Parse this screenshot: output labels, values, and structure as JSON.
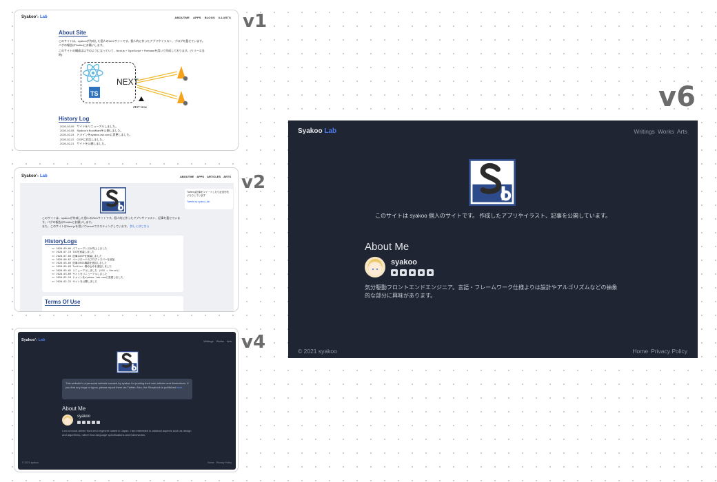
{
  "versions": {
    "v1": "v1",
    "v2": "v2",
    "v4": "v4",
    "v6": "v6"
  },
  "v1": {
    "brand_a": "Syakoo'",
    "brand_sep": "s",
    "brand_b": "Lab",
    "nav": [
      "ABOUTME",
      "APPS",
      "BLOGS",
      "ILLUSTS"
    ],
    "about_title": "About Site",
    "about_p1": "このサイトは、syakooが作成した個人のWebサイトです。個人的に作ったアプリやイラスト、ブログを載せています。バグの報告はTwitterにお願いします。",
    "about_p2": "このサイトの構成は以下のようになっていて、Next.js + TypeScript + Firebaseを用いて作成しております。(リリース当時)",
    "stack_next": "NEXT",
    "stack_ts": "TS",
    "stack_zeit": "ZEIT Now",
    "history_title": "History Log",
    "history": [
      "2020-03-09　サイトをリニューアルしました。",
      "2020-03-08　Syakoo's BookMarkを公開しました。",
      "2020-02-24　ドメインをsyakoo-lab.comに変更しました。",
      "2020-02-22　OGPに対応しました。",
      "2020-02-21　サイトを公開しました。"
    ]
  },
  "v2": {
    "brand_a": "Syakoo'",
    "brand_sep": "s",
    "brand_b": "Lab",
    "nav": [
      "ABOUTME",
      "APPS",
      "ARTICLES",
      "ARTS"
    ],
    "intro_p1": "このサイトは、syakooが作成した個人のWebサイトです。個人的に作ったアプリやイラスト、記事を載せています。バグの報告はTwitterにお願いします。",
    "intro_p2": "また、このサイトはNext.jsを用いてVercelでホスティングしています。",
    "intro_link": "詳しくはこちら",
    "side_text": "Twitterは記事をツイートしたり近況を呟いたりしています",
    "side_link": "Tweets by syakoo_lab",
    "history_title": "HistoryLogs",
    "history": [
      "<> 2020-09-06  パフォーマンスが向上しました",
      "<> 2020-07-19  TOCを実装しました",
      "<> 2020-07-05  記事のOGPを実装しました",
      "<> 2020-06-07  ページロードのプログレスバーを追加",
      "<> 2020-05-05  記事のRSS機能を追加しました",
      "<> 2020-05-03  Twitter 埋め込みを追加しました",
      "<> 2020-05-02  リニューアルしました (SSG + Vercel)",
      "<> 2020-03-09  サイトをリニューアルしました",
      "<> 2020-02-24  ドメインをsyakoo-lab.comに変更しました",
      "<> 2020-02-22  サイトを公開しました"
    ],
    "terms_title": "Terms Of Use"
  },
  "v4": {
    "brand_a": "Syakoo'",
    "brand_sep": "s",
    "brand_b": "Lab",
    "nav": [
      "Writings",
      "Works",
      "Arts"
    ],
    "notice": "This website is a personal website created by syakoo for posting their own articles and illustrations. If you find any bugs or typos, please report them via Twitter. Also, the Storybook is published",
    "notice_link": "here.",
    "about_title": "About Me",
    "username": "syakoo",
    "bio": "I am a mood-driven front-end engineer based in Japan. I am interested in abstract aspects such as design and algorithms, rather than language specifications and frameworks.",
    "copyright": "© 2021 syakoo",
    "footer_nav": [
      "Home",
      "Privacy Policy"
    ]
  },
  "v6": {
    "brand_a": "Syakoo",
    "brand_b": "Lab",
    "nav": [
      "Writings",
      "Works",
      "Arts"
    ],
    "tagline": "このサイトは syakoo 個人のサイトです。 作成したアプリやイラスト、記事を公開しています。",
    "about_title": "About Me",
    "username": "syakoo",
    "bio": "気分駆動フロントエンドエンジニア。言語・フレームワーク仕様よりは設計やアルゴリズムなどの抽象的な部分に興味があります。",
    "copyright": "© 2021 syakoo",
    "footer_nav": [
      "Home",
      "Privacy Policy"
    ]
  },
  "colors": {
    "dark_bg": "#1f2532",
    "accent": "#2563eb",
    "heading_blue": "#274690",
    "logo_blue": "#2d4b8a"
  },
  "icons": [
    "react-icon",
    "next-logo",
    "typescript-icon",
    "firebase-icon",
    "zeit-icon",
    "site-logo",
    "avatar",
    "github-icon",
    "x-icon",
    "zenn-icon",
    "steam-icon",
    "pixiv-icon"
  ]
}
